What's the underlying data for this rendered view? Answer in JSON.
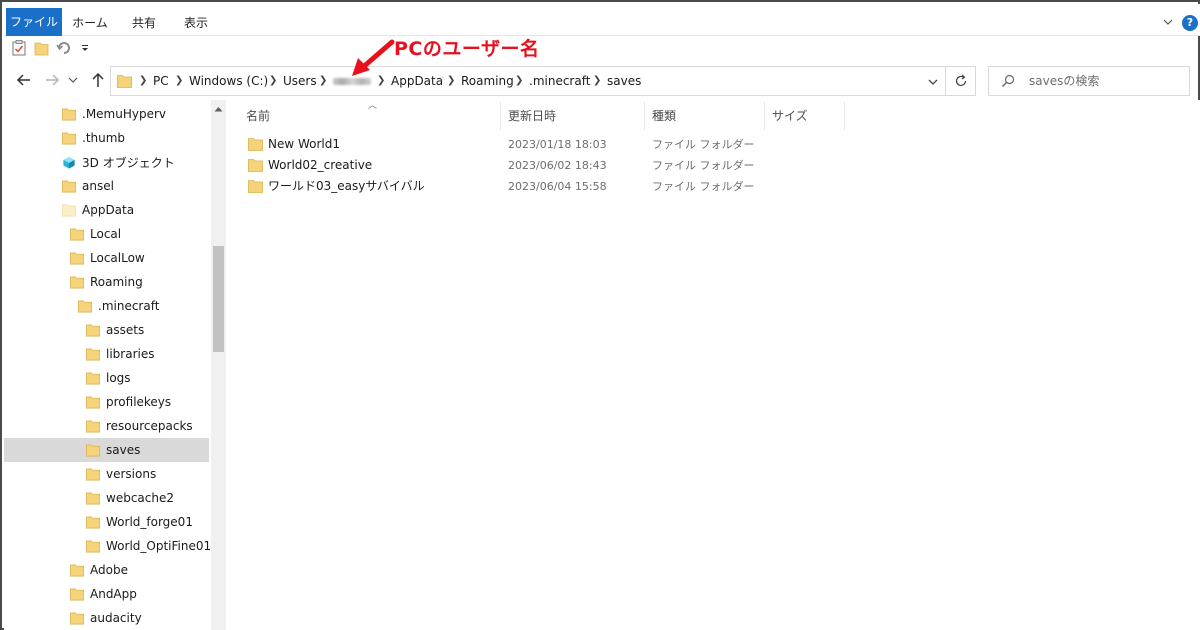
{
  "ribbon": {
    "tabs": [
      {
        "label": "ファイル",
        "active": true
      },
      {
        "label": "ホーム"
      },
      {
        "label": "共有"
      },
      {
        "label": "表示"
      }
    ],
    "help": "?"
  },
  "address": {
    "crumbs": [
      "PC",
      "Windows (C:)",
      "Users",
      "AppData",
      "Roaming",
      ".minecraft",
      "saves"
    ],
    "user_segment_blurred": true
  },
  "search": {
    "placeholder": "savesの検索"
  },
  "annotation": {
    "text": "PCのユーザー名",
    "color": "#e8101c"
  },
  "nav_pane": {
    "items": [
      {
        "label": ".MemuHyperv",
        "indent": 0,
        "icon": "folder-icon"
      },
      {
        "label": ".thumb",
        "indent": 0,
        "icon": "folder-icon"
      },
      {
        "label": "3D オブジェクト",
        "indent": 0,
        "icon": "3d-objects-icon"
      },
      {
        "label": "ansel",
        "indent": 0,
        "icon": "folder-icon"
      },
      {
        "label": "AppData",
        "indent": 0,
        "icon": "folder-faded-icon"
      },
      {
        "label": "Local",
        "indent": 1,
        "icon": "folder-icon"
      },
      {
        "label": "LocalLow",
        "indent": 1,
        "icon": "folder-icon"
      },
      {
        "label": "Roaming",
        "indent": 1,
        "icon": "folder-icon"
      },
      {
        "label": ".minecraft",
        "indent": 2,
        "icon": "folder-icon"
      },
      {
        "label": "assets",
        "indent": 3,
        "icon": "folder-icon"
      },
      {
        "label": "libraries",
        "indent": 3,
        "icon": "folder-icon"
      },
      {
        "label": "logs",
        "indent": 3,
        "icon": "folder-icon"
      },
      {
        "label": "profilekeys",
        "indent": 3,
        "icon": "folder-icon"
      },
      {
        "label": "resourcepacks",
        "indent": 3,
        "icon": "folder-icon"
      },
      {
        "label": "saves",
        "indent": 3,
        "icon": "folder-icon",
        "selected": true
      },
      {
        "label": "versions",
        "indent": 3,
        "icon": "folder-icon"
      },
      {
        "label": "webcache2",
        "indent": 3,
        "icon": "folder-icon"
      },
      {
        "label": "World_forge01",
        "indent": 3,
        "icon": "folder-icon"
      },
      {
        "label": "World_OptiFine01",
        "indent": 3,
        "icon": "folder-icon"
      },
      {
        "label": "Adobe",
        "indent": 1,
        "icon": "folder-icon"
      },
      {
        "label": "AndApp",
        "indent": 1,
        "icon": "folder-icon"
      },
      {
        "label": "audacity",
        "indent": 1,
        "icon": "folder-icon"
      }
    ]
  },
  "columns": [
    {
      "label": "名前"
    },
    {
      "label": "更新日時"
    },
    {
      "label": "種類"
    },
    {
      "label": "サイズ"
    }
  ],
  "files": [
    {
      "name": "New World1",
      "modified": "2023/01/18 18:03",
      "type": "ファイル フォルダー"
    },
    {
      "name": "World02_creative",
      "modified": "2023/06/02 18:43",
      "type": "ファイル フォルダー"
    },
    {
      "name": "ワールド03_easyサバイバル",
      "modified": "2023/06/04 15:58",
      "type": "ファイル フォルダー"
    }
  ],
  "colors": {
    "accent": "#1a6fc9",
    "folder": "#f5d37a",
    "selected_row": "#d9d9d9",
    "annotation": "#e8101c"
  }
}
